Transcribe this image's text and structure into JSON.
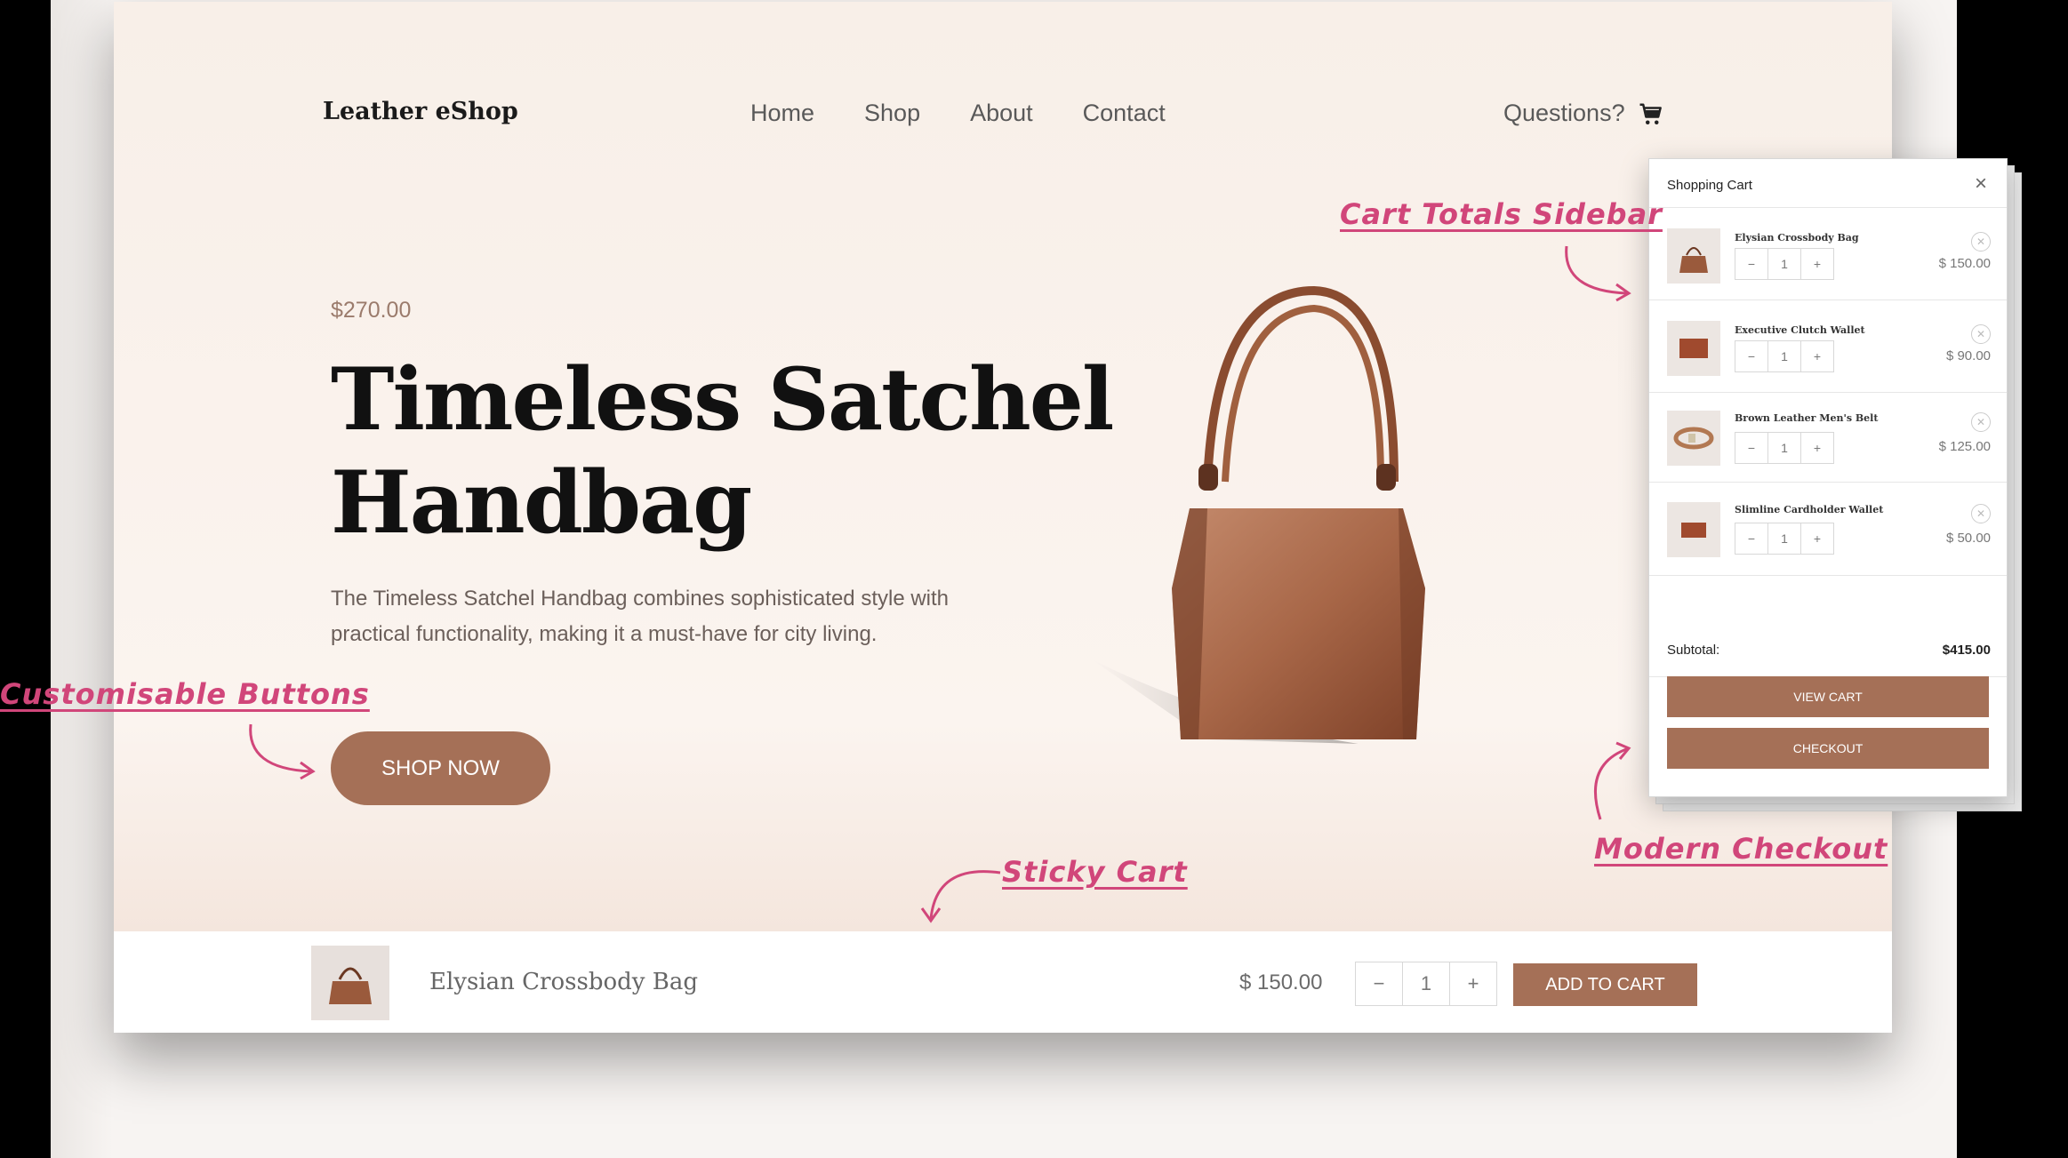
{
  "header": {
    "logo": "Leather eShop",
    "nav": [
      "Home",
      "Shop",
      "About",
      "Contact"
    ],
    "questions": "Questions?"
  },
  "hero": {
    "price": "$270.00",
    "title": "Timeless Satchel Handbag",
    "description": "The Timeless Satchel Handbag combines sophisticated style with practical functionality, making it a must-have for city living.",
    "button": "SHOP NOW"
  },
  "sticky_cart": {
    "product_name": "Elysian Crossbody Bag",
    "price": "$ 150.00",
    "qty_minus": "−",
    "qty": "1",
    "qty_plus": "+",
    "add_button": "ADD TO CART"
  },
  "cart_drawer": {
    "title": "Shopping Cart",
    "close": "×",
    "items": [
      {
        "name": "Elysian Crossbody Bag",
        "qty": "1",
        "price": "$ 150.00"
      },
      {
        "name": "Executive Clutch Wallet",
        "qty": "1",
        "price": "$ 90.00"
      },
      {
        "name": "Brown Leather Men's Belt",
        "qty": "1",
        "price": "$ 125.00"
      },
      {
        "name": "Slimline Cardholder Wallet",
        "qty": "1",
        "price": "$ 50.00"
      }
    ],
    "subtotal_label": "Subtotal:",
    "subtotal_value": "$415.00",
    "view_cart": "VIEW CART",
    "checkout": "CHECKOUT"
  },
  "annotations": {
    "cart_totals": "Cart Totals Sidebar",
    "buttons": "Customisable Buttons",
    "sticky": "Sticky Cart",
    "checkout": "Modern Checkout"
  },
  "colors": {
    "accent": "#a57057",
    "annotation": "#d1467a",
    "hero_bg": "#f8efe8"
  },
  "icons": {
    "cart": "cart-icon",
    "close": "close-icon",
    "remove": "remove-circle-icon"
  }
}
